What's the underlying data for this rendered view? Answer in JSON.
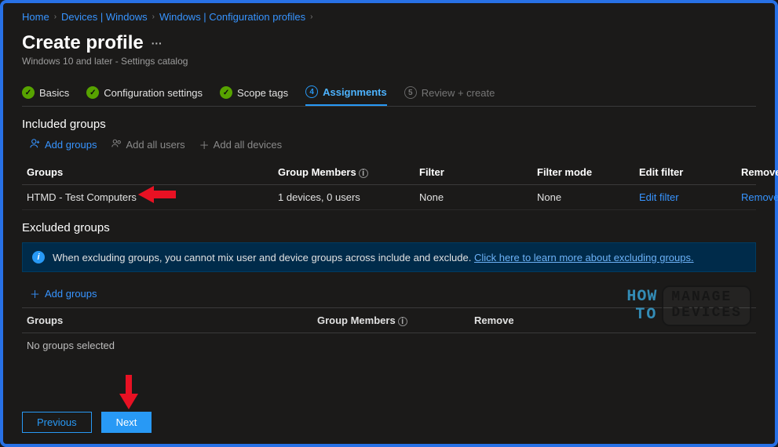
{
  "breadcrumb": {
    "items": [
      "Home",
      "Devices | Windows",
      "Windows | Configuration profiles"
    ]
  },
  "header": {
    "title": "Create profile",
    "subtitle": "Windows 10 and later - Settings catalog"
  },
  "steps": {
    "s1": "Basics",
    "s2": "Configuration settings",
    "s3": "Scope tags",
    "s4": "Assignments",
    "s5": "Review + create",
    "num4": "4",
    "num5": "5"
  },
  "included": {
    "section": "Included groups",
    "add_groups": "Add groups",
    "add_all_users": "Add all users",
    "add_all_devices": "Add all devices",
    "headers": {
      "groups": "Groups",
      "members": "Group Members",
      "filter": "Filter",
      "filter_mode": "Filter mode",
      "edit_filter": "Edit filter",
      "remove": "Remove"
    },
    "row": {
      "name": "HTMD - Test Computers",
      "members": "1 devices, 0 users",
      "filter": "None",
      "filter_mode": "None",
      "edit": "Edit filter",
      "remove": "Remove"
    }
  },
  "excluded": {
    "section": "Excluded groups",
    "info_text": "When excluding groups, you cannot mix user and device groups across include and exclude. ",
    "info_link": "Click here to learn more about excluding groups.",
    "add_groups": "Add groups",
    "headers": {
      "groups": "Groups",
      "members": "Group Members",
      "remove": "Remove"
    },
    "empty": "No groups selected"
  },
  "footer": {
    "previous": "Previous",
    "next": "Next"
  },
  "watermark": {
    "how": "HOW",
    "to": "TO",
    "manage": "MANAGE",
    "devices": "DEVICES"
  }
}
